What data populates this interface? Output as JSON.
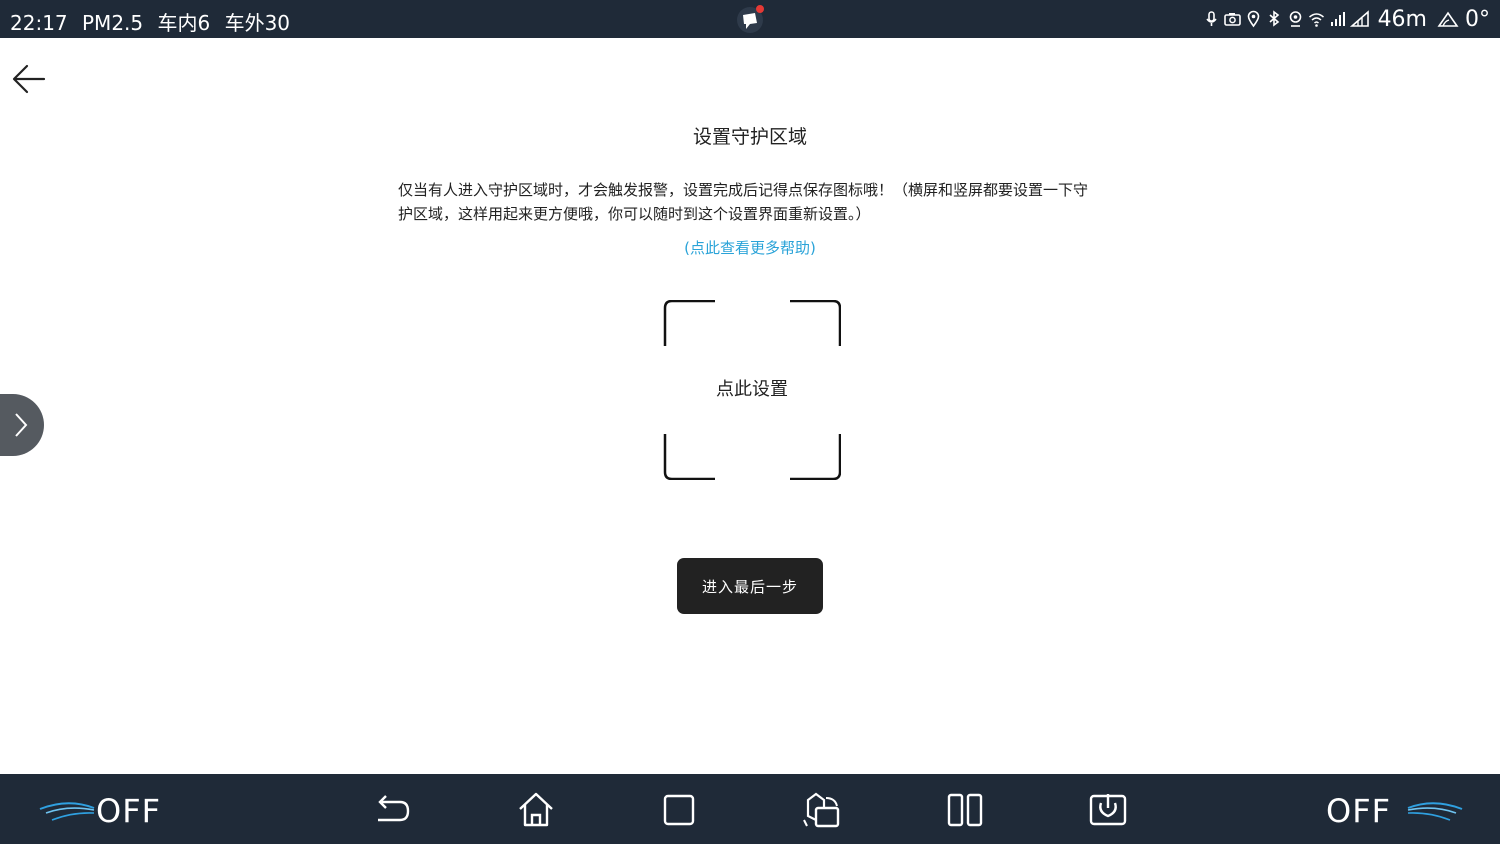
{
  "status_bar": {
    "time": "22:17",
    "pm25": "PM2.5",
    "inside": "车内6",
    "outside": "车外30",
    "altitude": "46m",
    "angle": "0°"
  },
  "page": {
    "title": "设置守护区域",
    "description": "仅当有人进入守护区域时，才会触发报警，设置完成后记得点保存图标哦！（横屏和竖屏都要设置一下守护区域，这样用起来更方便哦，你可以随时到这个设置界面重新设置。）",
    "help_link": "(点此查看更多帮助)",
    "setup_label": "点此设置",
    "next_button": "进入最后一步"
  },
  "nav_bar": {
    "left_status": "OFF",
    "right_status": "OFF"
  },
  "colors": {
    "status_bg": "#1f2a38",
    "link": "#2aa3d8",
    "button_bg": "#222222"
  }
}
